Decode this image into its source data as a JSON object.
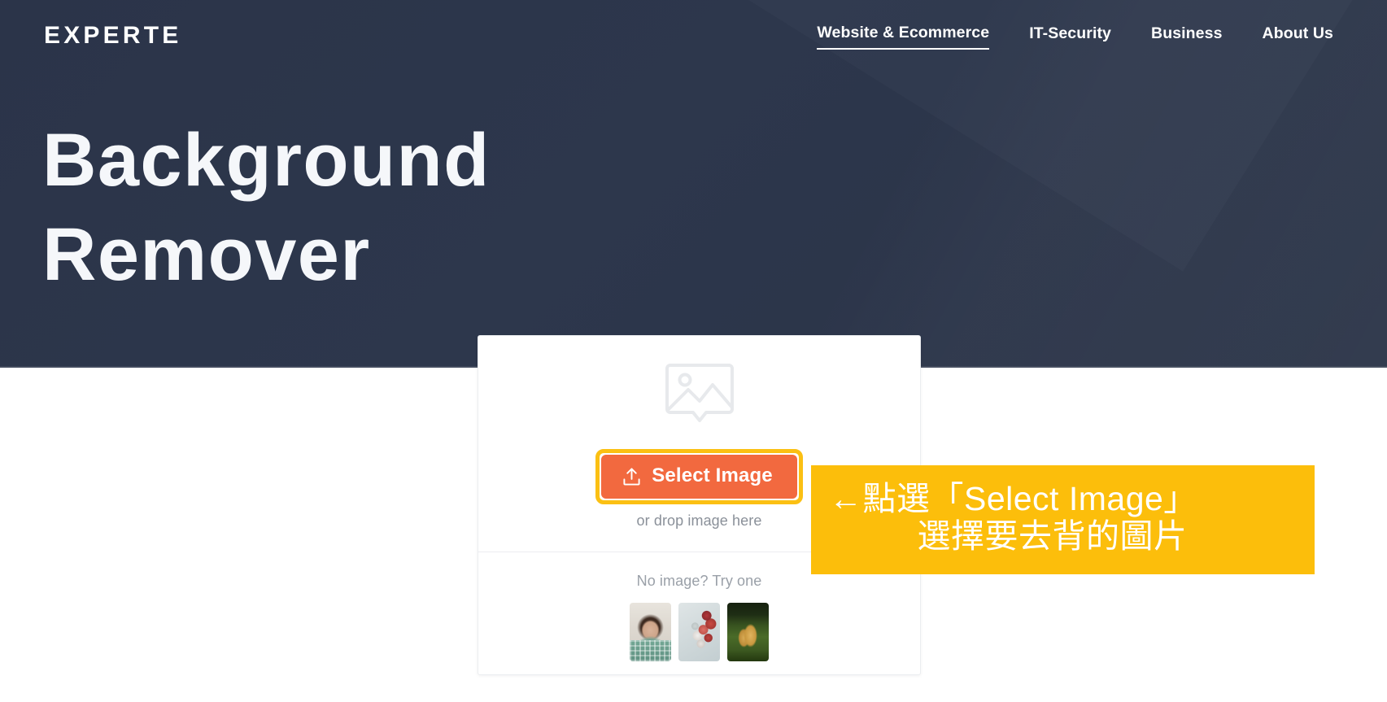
{
  "header": {
    "logo": "EXPERTE",
    "nav": [
      {
        "label": "Website & Ecommerce",
        "active": true
      },
      {
        "label": "IT-Security",
        "active": false
      },
      {
        "label": "Business",
        "active": false
      },
      {
        "label": "About Us",
        "active": false
      }
    ]
  },
  "hero": {
    "title": "Background\nRemover",
    "background_color": "#2d374c",
    "text_color": "#f5f7fa"
  },
  "upload_card": {
    "placeholder_icon": "image-placeholder-icon",
    "select_button": {
      "label": "Select Image",
      "icon": "upload-icon",
      "background_color": "#f2693f",
      "text_color": "#ffffff",
      "highlight_color": "#fbc013"
    },
    "drop_hint": "or drop image here",
    "try_label": "No image? Try one",
    "thumbnails": [
      {
        "name": "woman-portrait-thumbnail",
        "description": "woman with curly dark hair in green plaid shirt"
      },
      {
        "name": "red-ornaments-thumbnail",
        "description": "red and white christmas ornaments"
      },
      {
        "name": "dog-on-grass-thumbnail",
        "description": "tan dog standing on green grass"
      }
    ]
  },
  "annotation": {
    "line_1": "←點選「Select Image」",
    "line_2": "選擇要去背的圖片",
    "background_color": "#fcbe0b",
    "text_color": "#ffffff"
  }
}
